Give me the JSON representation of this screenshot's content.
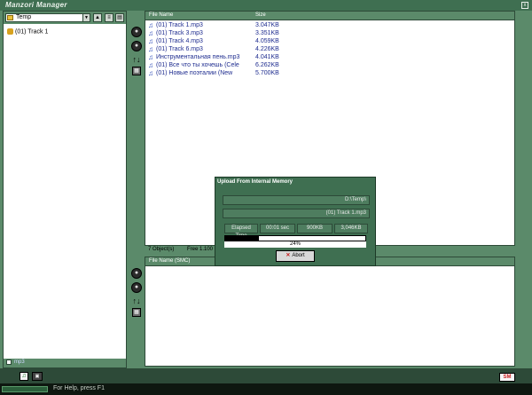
{
  "window": {
    "title": "Manzori Manager",
    "close_label": "x"
  },
  "left_panel": {
    "folder_value": "Temp",
    "tree_items": [
      {
        "label": "(01) Track 1"
      }
    ],
    "footer_label": "mp3"
  },
  "file_pane": {
    "columns": {
      "name": "File Name",
      "size": "Size"
    },
    "rows": [
      {
        "name": "(01) Track 1.mp3",
        "size": "3.047KB"
      },
      {
        "name": "(01) Track 3.mp3",
        "size": "3.351KB"
      },
      {
        "name": "(01) Track 4.mp3",
        "size": "4.059KB"
      },
      {
        "name": "(01) Track 6.mp3",
        "size": "4.226KB"
      },
      {
        "name": "Инструментальная пень.mp3",
        "size": "4.041KB"
      },
      {
        "name": "(01) Все что ты хочешь (Cele",
        "size": "6.262KB"
      },
      {
        "name": "(01) Новые поэталии (New",
        "size": "5.700KB"
      }
    ],
    "status_objects": "7 Object(s)",
    "status_free": "Free 1.100"
  },
  "smc_pane": {
    "columns": {
      "name": "File Name (SMC)"
    }
  },
  "dialog": {
    "title": "Upload From Internal Memory",
    "dest_path": "D:\\Temp\\",
    "current_file": "(01) Track 1.mp3",
    "elapsed_label": "Elapsed Time",
    "elapsed_value": "00:01 sec",
    "transferred": "900KB",
    "total": "3,046KB",
    "progress": 0.24,
    "percent_label": "24%",
    "abort_label": "Abort"
  },
  "taskbar": {
    "message": "For Help, press F1",
    "logo_text": "SM"
  }
}
